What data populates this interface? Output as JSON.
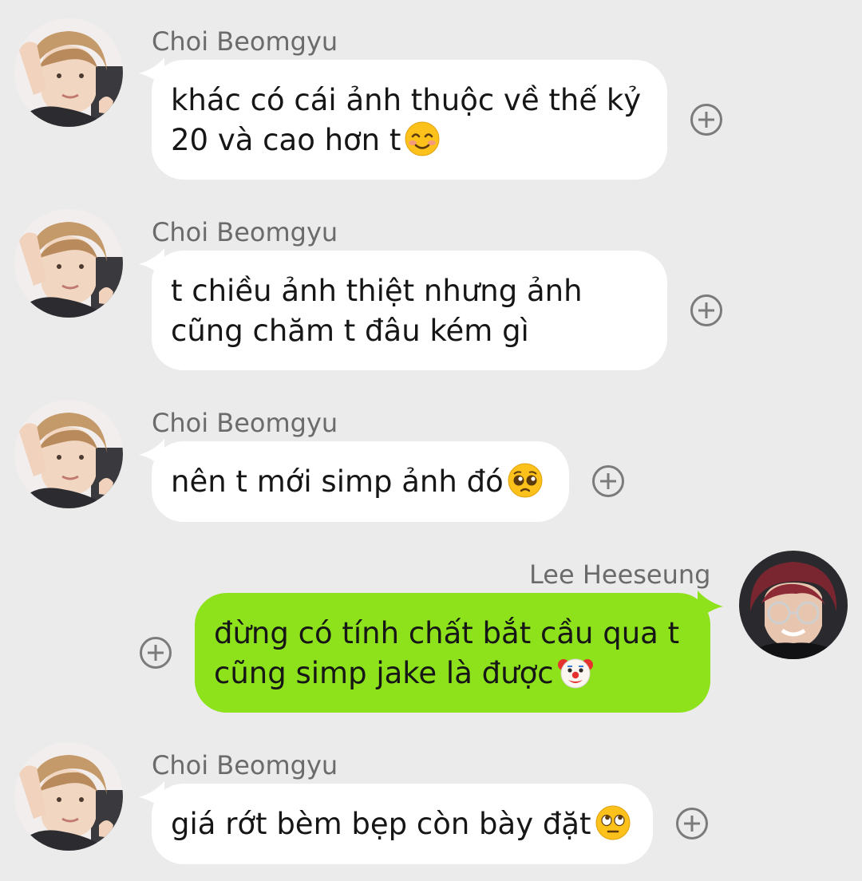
{
  "colors": {
    "background": "#ebebeb",
    "incoming_bubble": "#ffffff",
    "outgoing_bubble": "#8ee21b",
    "sender_name": "#6b6b6b",
    "add_reaction": "#7b7b7b"
  },
  "messages": [
    {
      "sender": "Choi Beomgyu",
      "direction": "incoming",
      "avatar_icon": "avatar-choi-beomgyu",
      "lines": [
        "khác có cái ảnh thuộc về thế kỷ",
        "20 và cao hơn t"
      ],
      "emoji": "smiling-face-with-smiling-eyes-emoji"
    },
    {
      "sender": "Choi Beomgyu",
      "direction": "incoming",
      "avatar_icon": "avatar-choi-beomgyu",
      "lines": [
        "t chiều ảnh thiệt nhưng ảnh",
        "cũng chăm t đâu kém gì"
      ],
      "emoji": null
    },
    {
      "sender": "Choi Beomgyu",
      "direction": "incoming",
      "avatar_icon": "avatar-choi-beomgyu",
      "lines": [
        "nên t mới simp ảnh đó"
      ],
      "emoji": "pleading-face-emoji"
    },
    {
      "sender": "Lee Heeseung",
      "direction": "outgoing",
      "avatar_icon": "avatar-lee-heeseung",
      "lines": [
        "đừng có tính chất bắt cầu qua t",
        "cũng simp jake là được"
      ],
      "emoji": "clown-face-emoji"
    },
    {
      "sender": "Choi Beomgyu",
      "direction": "incoming",
      "avatar_icon": "avatar-choi-beomgyu",
      "lines": [
        "giá rớt bèm bẹp còn bày đặt"
      ],
      "emoji": "face-with-rolling-eyes-emoji"
    }
  ],
  "add_reaction_icon": "plus-circle-icon"
}
